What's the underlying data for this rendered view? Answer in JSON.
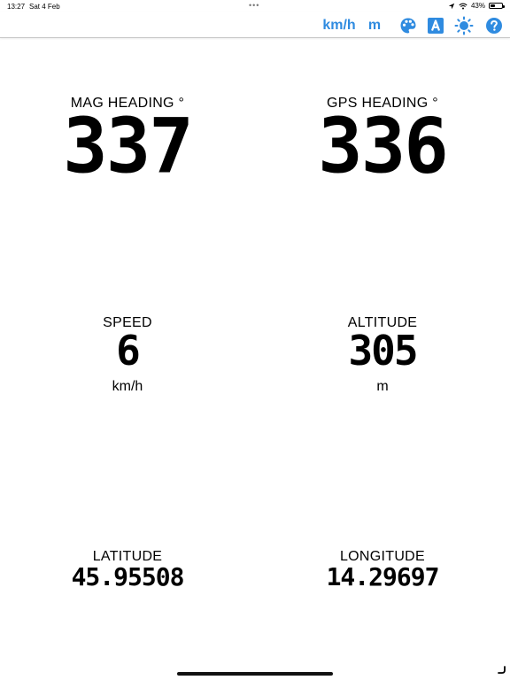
{
  "status_bar": {
    "time": "13:27",
    "date": "Sat 4 Feb",
    "dots": "•••",
    "battery_pct": "43%",
    "battery_level": 0.43
  },
  "toolbar": {
    "speed_unit": "km/h",
    "altitude_unit": "m",
    "palette_icon": "palette-icon",
    "font_icon": "font-a-icon",
    "brightness_icon": "brightness-icon",
    "help_icon": "help-icon",
    "accent": "#2f8be0"
  },
  "readouts": {
    "mag_heading": {
      "label": "MAG HEADING °",
      "value": "337"
    },
    "gps_heading": {
      "label": "GPS HEADING °",
      "value": "336"
    },
    "speed": {
      "label": "SPEED",
      "value": "6",
      "unit": "km/h"
    },
    "altitude": {
      "label": "ALTITUDE",
      "value": "305",
      "unit": "m"
    },
    "latitude": {
      "label": "LATITUDE",
      "value": "45.95508"
    },
    "longitude": {
      "label": "LONGITUDE",
      "value": "14.29697"
    }
  }
}
